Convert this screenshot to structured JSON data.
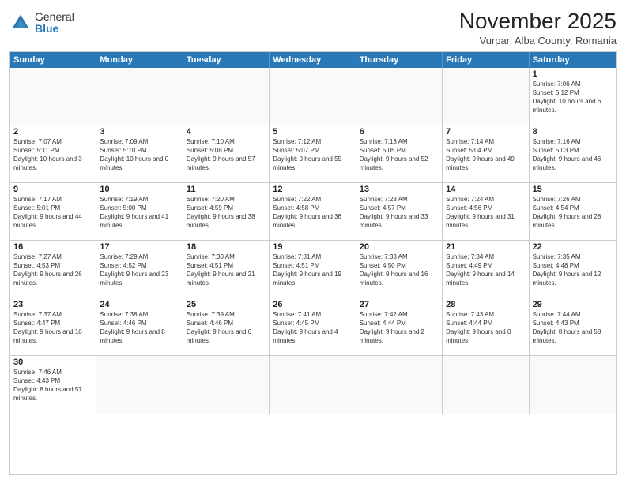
{
  "header": {
    "logo_general": "General",
    "logo_blue": "Blue",
    "month_title": "November 2025",
    "location": "Vurpar, Alba County, Romania"
  },
  "weekdays": [
    "Sunday",
    "Monday",
    "Tuesday",
    "Wednesday",
    "Thursday",
    "Friday",
    "Saturday"
  ],
  "rows": [
    [
      {
        "day": "",
        "info": ""
      },
      {
        "day": "",
        "info": ""
      },
      {
        "day": "",
        "info": ""
      },
      {
        "day": "",
        "info": ""
      },
      {
        "day": "",
        "info": ""
      },
      {
        "day": "",
        "info": ""
      },
      {
        "day": "1",
        "info": "Sunrise: 7:06 AM\nSunset: 5:12 PM\nDaylight: 10 hours and 6 minutes."
      }
    ],
    [
      {
        "day": "2",
        "info": "Sunrise: 7:07 AM\nSunset: 5:11 PM\nDaylight: 10 hours and 3 minutes."
      },
      {
        "day": "3",
        "info": "Sunrise: 7:09 AM\nSunset: 5:10 PM\nDaylight: 10 hours and 0 minutes."
      },
      {
        "day": "4",
        "info": "Sunrise: 7:10 AM\nSunset: 5:08 PM\nDaylight: 9 hours and 57 minutes."
      },
      {
        "day": "5",
        "info": "Sunrise: 7:12 AM\nSunset: 5:07 PM\nDaylight: 9 hours and 55 minutes."
      },
      {
        "day": "6",
        "info": "Sunrise: 7:13 AM\nSunset: 5:05 PM\nDaylight: 9 hours and 52 minutes."
      },
      {
        "day": "7",
        "info": "Sunrise: 7:14 AM\nSunset: 5:04 PM\nDaylight: 9 hours and 49 minutes."
      },
      {
        "day": "8",
        "info": "Sunrise: 7:16 AM\nSunset: 5:03 PM\nDaylight: 9 hours and 46 minutes."
      }
    ],
    [
      {
        "day": "9",
        "info": "Sunrise: 7:17 AM\nSunset: 5:01 PM\nDaylight: 9 hours and 44 minutes."
      },
      {
        "day": "10",
        "info": "Sunrise: 7:19 AM\nSunset: 5:00 PM\nDaylight: 9 hours and 41 minutes."
      },
      {
        "day": "11",
        "info": "Sunrise: 7:20 AM\nSunset: 4:59 PM\nDaylight: 9 hours and 38 minutes."
      },
      {
        "day": "12",
        "info": "Sunrise: 7:22 AM\nSunset: 4:58 PM\nDaylight: 9 hours and 36 minutes."
      },
      {
        "day": "13",
        "info": "Sunrise: 7:23 AM\nSunset: 4:57 PM\nDaylight: 9 hours and 33 minutes."
      },
      {
        "day": "14",
        "info": "Sunrise: 7:24 AM\nSunset: 4:56 PM\nDaylight: 9 hours and 31 minutes."
      },
      {
        "day": "15",
        "info": "Sunrise: 7:26 AM\nSunset: 4:54 PM\nDaylight: 9 hours and 28 minutes."
      }
    ],
    [
      {
        "day": "16",
        "info": "Sunrise: 7:27 AM\nSunset: 4:53 PM\nDaylight: 9 hours and 26 minutes."
      },
      {
        "day": "17",
        "info": "Sunrise: 7:29 AM\nSunset: 4:52 PM\nDaylight: 9 hours and 23 minutes."
      },
      {
        "day": "18",
        "info": "Sunrise: 7:30 AM\nSunset: 4:51 PM\nDaylight: 9 hours and 21 minutes."
      },
      {
        "day": "19",
        "info": "Sunrise: 7:31 AM\nSunset: 4:51 PM\nDaylight: 9 hours and 19 minutes."
      },
      {
        "day": "20",
        "info": "Sunrise: 7:33 AM\nSunset: 4:50 PM\nDaylight: 9 hours and 16 minutes."
      },
      {
        "day": "21",
        "info": "Sunrise: 7:34 AM\nSunset: 4:49 PM\nDaylight: 9 hours and 14 minutes."
      },
      {
        "day": "22",
        "info": "Sunrise: 7:35 AM\nSunset: 4:48 PM\nDaylight: 9 hours and 12 minutes."
      }
    ],
    [
      {
        "day": "23",
        "info": "Sunrise: 7:37 AM\nSunset: 4:47 PM\nDaylight: 9 hours and 10 minutes."
      },
      {
        "day": "24",
        "info": "Sunrise: 7:38 AM\nSunset: 4:46 PM\nDaylight: 9 hours and 8 minutes."
      },
      {
        "day": "25",
        "info": "Sunrise: 7:39 AM\nSunset: 4:46 PM\nDaylight: 9 hours and 6 minutes."
      },
      {
        "day": "26",
        "info": "Sunrise: 7:41 AM\nSunset: 4:45 PM\nDaylight: 9 hours and 4 minutes."
      },
      {
        "day": "27",
        "info": "Sunrise: 7:42 AM\nSunset: 4:44 PM\nDaylight: 9 hours and 2 minutes."
      },
      {
        "day": "28",
        "info": "Sunrise: 7:43 AM\nSunset: 4:44 PM\nDaylight: 9 hours and 0 minutes."
      },
      {
        "day": "29",
        "info": "Sunrise: 7:44 AM\nSunset: 4:43 PM\nDaylight: 8 hours and 58 minutes."
      }
    ],
    [
      {
        "day": "30",
        "info": "Sunrise: 7:46 AM\nSunset: 4:43 PM\nDaylight: 8 hours and 57 minutes."
      },
      {
        "day": "",
        "info": ""
      },
      {
        "day": "",
        "info": ""
      },
      {
        "day": "",
        "info": ""
      },
      {
        "day": "",
        "info": ""
      },
      {
        "day": "",
        "info": ""
      },
      {
        "day": "",
        "info": ""
      }
    ]
  ]
}
